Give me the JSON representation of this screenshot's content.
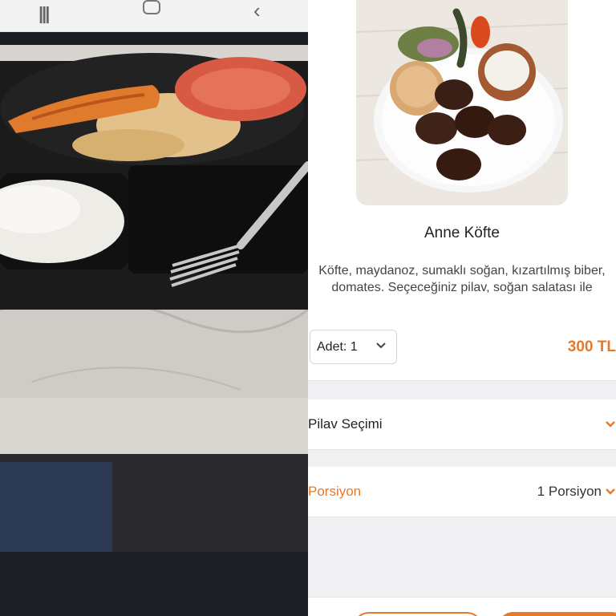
{
  "product": {
    "name": "Anne Köfte",
    "description": "Köfte, maydanoz, sumaklı soğan, kızartılmış biber, domates. Seçeceğiniz pilav, soğan salatası ile",
    "quantity_label": "Adet: 1",
    "price": "300 TL"
  },
  "options": {
    "pilav": {
      "title": "Pilav Seçimi"
    },
    "porsiyon": {
      "title": "Porsiyon",
      "value": "1 Porsiyon"
    }
  },
  "colors": {
    "accent": "#e8792a",
    "separator": "#f0f0f2"
  },
  "icons": {
    "nav_recents": "recents-icon",
    "nav_home": "home-icon",
    "nav_back": "back-icon",
    "chevron": "chevron-down-icon"
  }
}
